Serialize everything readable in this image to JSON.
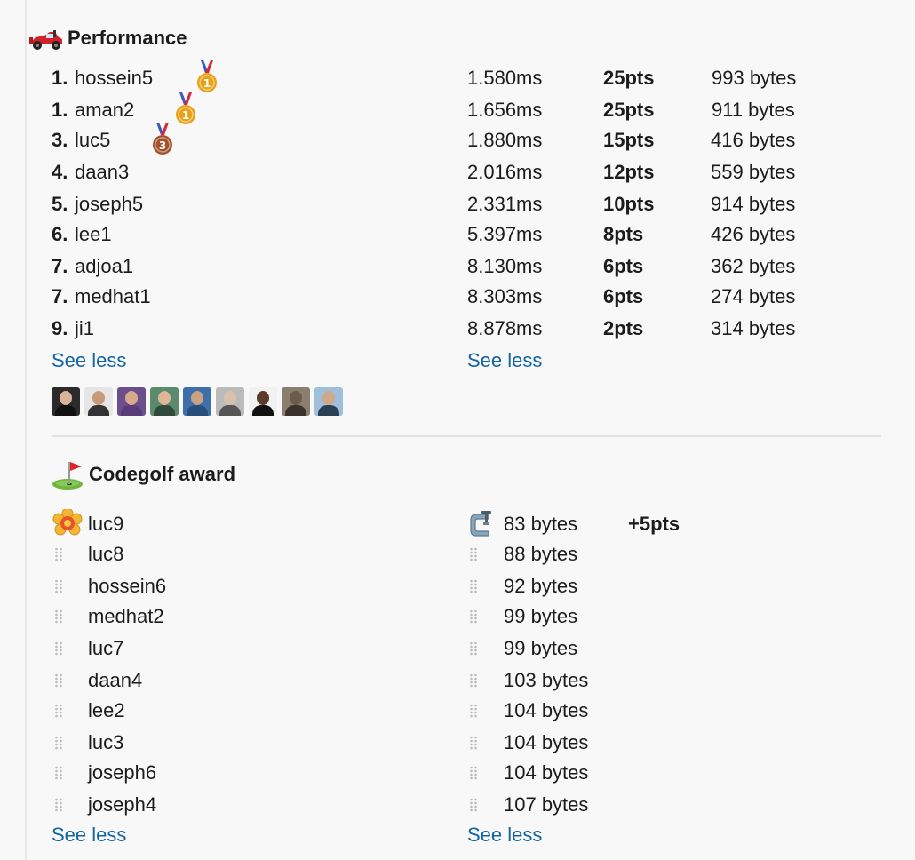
{
  "performance": {
    "title": "Performance",
    "icon": "racing-car-icon",
    "rows": [
      {
        "rank": "1.",
        "name": "hossein5",
        "time": "1.580ms",
        "pts": "25pts",
        "size": "993 bytes",
        "medal": "gold"
      },
      {
        "rank": "1.",
        "name": "aman2",
        "time": "1.656ms",
        "pts": "25pts",
        "size": "911 bytes",
        "medal": "gold"
      },
      {
        "rank": "3.",
        "name": "luc5",
        "time": "1.880ms",
        "pts": "15pts",
        "size": "416 bytes",
        "medal": "bronze"
      },
      {
        "rank": "4.",
        "name": "daan3",
        "time": "2.016ms",
        "pts": "12pts",
        "size": "559 bytes",
        "medal": ""
      },
      {
        "rank": "5.",
        "name": "joseph5",
        "time": "2.331ms",
        "pts": "10pts",
        "size": "914 bytes",
        "medal": ""
      },
      {
        "rank": "6.",
        "name": "lee1",
        "time": "5.397ms",
        "pts": "8pts",
        "size": "426 bytes",
        "medal": ""
      },
      {
        "rank": "7.",
        "name": "adjoa1",
        "time": "8.130ms",
        "pts": "6pts",
        "size": "362 bytes",
        "medal": ""
      },
      {
        "rank": "7.",
        "name": "medhat1",
        "time": "8.303ms",
        "pts": "6pts",
        "size": "274 bytes",
        "medal": ""
      },
      {
        "rank": "9.",
        "name": "ji1",
        "time": "8.878ms",
        "pts": "2pts",
        "size": "314 bytes",
        "medal": ""
      }
    ],
    "medal_labels": {
      "gold": "1",
      "bronze": "3"
    },
    "see_less_left": "See less",
    "see_less_right": "See less",
    "avatar_count": 9
  },
  "codegolf": {
    "title": "Codegolf award",
    "icon": "golf-flag-icon",
    "rows": [
      {
        "name": "luc9",
        "size": "83 bytes",
        "bonus": "+5pts",
        "winner": true
      },
      {
        "name": "luc8",
        "size": "88 bytes",
        "bonus": "",
        "winner": false
      },
      {
        "name": "hossein6",
        "size": "92 bytes",
        "bonus": "",
        "winner": false
      },
      {
        "name": "medhat2",
        "size": "99 bytes",
        "bonus": "",
        "winner": false
      },
      {
        "name": "luc7",
        "size": "99 bytes",
        "bonus": "",
        "winner": false
      },
      {
        "name": "daan4",
        "size": "103 bytes",
        "bonus": "",
        "winner": false
      },
      {
        "name": "lee2",
        "size": "104 bytes",
        "bonus": "",
        "winner": false
      },
      {
        "name": "luc3",
        "size": "104 bytes",
        "bonus": "",
        "winner": false
      },
      {
        "name": "joseph6",
        "size": "104 bytes",
        "bonus": "",
        "winner": false
      },
      {
        "name": "joseph4",
        "size": "107 bytes",
        "bonus": "",
        "winner": false
      }
    ],
    "see_less_left": "See less",
    "see_less_right": "See less"
  },
  "colors": {
    "link": "#1264a3",
    "text": "#1d1c1d",
    "divider": "#e2e2e2",
    "gold": "#e8a21a",
    "bronze": "#a4502a"
  }
}
